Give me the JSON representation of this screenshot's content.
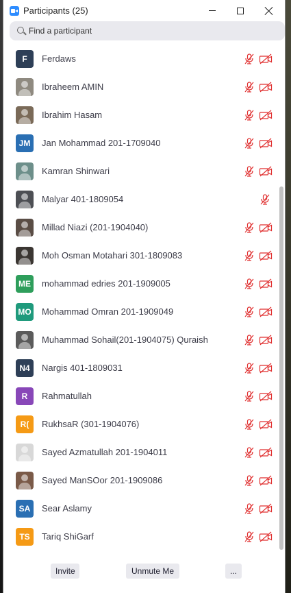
{
  "window": {
    "title": "Participants (25)",
    "icon": "zoom-camera-icon",
    "controls": [
      "minimize-icon",
      "maximize-icon",
      "close-icon"
    ]
  },
  "search": {
    "placeholder": "Find a participant",
    "value": ""
  },
  "participants": [
    {
      "name": "Ferdaws",
      "initials": "F",
      "avatar_color": "#2e3f57",
      "photo": false,
      "mic": "muted",
      "video": "off"
    },
    {
      "name": "Ibraheem AMIN",
      "initials": "",
      "avatar_color": "#8f8a80",
      "photo": true,
      "mic": "muted",
      "video": "off"
    },
    {
      "name": "Ibrahim Hasam",
      "initials": "",
      "avatar_color": "#7a6a58",
      "photo": true,
      "mic": "muted",
      "video": "off"
    },
    {
      "name": "Jan Mohammad 201-1709040",
      "initials": "JM",
      "avatar_color": "#2a6fb3",
      "photo": false,
      "mic": "muted",
      "video": "off"
    },
    {
      "name": "Kamran Shinwari",
      "initials": "",
      "avatar_color": "#6d8f8a",
      "photo": true,
      "mic": "muted",
      "video": "off"
    },
    {
      "name": "Malyar 401-1809054",
      "initials": "",
      "avatar_color": "#4d4f54",
      "photo": true,
      "mic": "muted",
      "video": "none"
    },
    {
      "name": "Millad Niazi (201-1904040)",
      "initials": "",
      "avatar_color": "#5a4d45",
      "photo": true,
      "mic": "muted",
      "video": "off"
    },
    {
      "name": "Moh Osman Motahari 301-1809083",
      "initials": "",
      "avatar_color": "#3b3632",
      "photo": true,
      "mic": "muted",
      "video": "off"
    },
    {
      "name": "mohammad edries 201-1909005",
      "initials": "ME",
      "avatar_color": "#2e9e5b",
      "photo": false,
      "mic": "muted",
      "video": "off"
    },
    {
      "name": "Mohammad Omran 201-1909049",
      "initials": "MO",
      "avatar_color": "#1f9a7c",
      "photo": false,
      "mic": "muted",
      "video": "off"
    },
    {
      "name": "Muhammad Sohail(201-1904075) Quraish",
      "initials": "",
      "avatar_color": "#5b5b5b",
      "photo": true,
      "mic": "muted",
      "video": "off"
    },
    {
      "name": "Nargis 401-1809031",
      "initials": "N4",
      "avatar_color": "#2e3f57",
      "photo": false,
      "mic": "muted",
      "video": "off"
    },
    {
      "name": "Rahmatullah",
      "initials": "R",
      "avatar_color": "#8847b8",
      "photo": false,
      "mic": "muted",
      "video": "off"
    },
    {
      "name": "RukhsaR (301-1904076)",
      "initials": "R(",
      "avatar_color": "#f59a15",
      "photo": false,
      "mic": "muted",
      "video": "off"
    },
    {
      "name": "Sayed Azmatullah 201-1904011",
      "initials": "",
      "avatar_color": "#d8d8d8",
      "photo": true,
      "mic": "muted",
      "video": "off"
    },
    {
      "name": "Sayed ManSOor 201-1909086",
      "initials": "",
      "avatar_color": "#7a5a48",
      "photo": true,
      "mic": "muted",
      "video": "off"
    },
    {
      "name": "Sear Aslamy",
      "initials": "SA",
      "avatar_color": "#2a6fb3",
      "photo": false,
      "mic": "muted",
      "video": "off"
    },
    {
      "name": "Tariq ShiGarf",
      "initials": "TS",
      "avatar_color": "#f59a15",
      "photo": false,
      "mic": "muted",
      "video": "off"
    }
  ],
  "status_icons": {
    "mic": "muted-mic-icon",
    "video": "video-off-icon"
  },
  "colors": {
    "muted_red": "#e02f2f",
    "accent": "#2d8cff"
  },
  "footer": {
    "invite_label": "Invite",
    "unmute_label": "Unmute Me",
    "more_label": "..."
  }
}
